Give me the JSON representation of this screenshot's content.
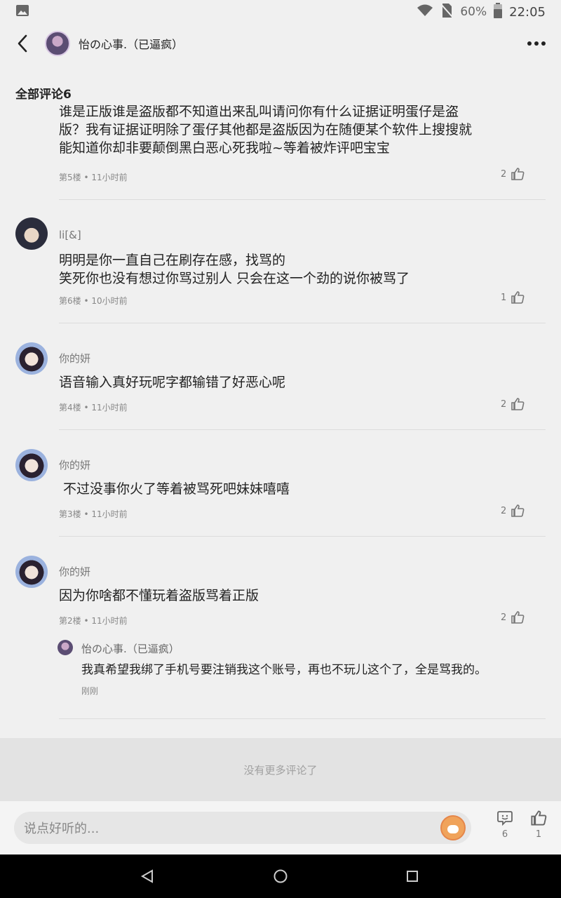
{
  "status_bar": {
    "battery_percent": "60%",
    "time": "22:05"
  },
  "header": {
    "title": "怡の心事.（已逼疯）"
  },
  "section": {
    "title": "全部评论6"
  },
  "comments": [
    {
      "text_lines": [
        "谁是正版谁是盗版都不知道出来乱叫请问你有什么证据证明蛋仔是盗",
        "版？我有证据证明除了蛋仔其他都是盗版因为在随便某个软件上搜搜就",
        "能知道你却非要颠倒黑白恶心死我啦~等着被炸评吧宝宝"
      ],
      "meta": "第5楼 • 11小时前",
      "likes": "2"
    },
    {
      "name": "li[&]",
      "text_lines": [
        "明明是你一直自己在刷存在感，找骂的",
        "笑死你也没有想过你骂过别人 只会在这一个劲的说你被骂了"
      ],
      "meta": "第6楼 • 10小时前",
      "likes": "1"
    },
    {
      "name": "你的妍",
      "text": "语音输入真好玩呢字都输错了好恶心呢",
      "meta": "第4楼 • 11小时前",
      "likes": "2"
    },
    {
      "name": "你的妍",
      "text": " 不过没事你火了等着被骂死吧妹妹嘻嘻",
      "meta": "第3楼 • 11小时前",
      "likes": "2"
    },
    {
      "name": "你的妍",
      "text": "因为你啥都不懂玩着盗版骂着正版",
      "meta": "第2楼 • 11小时前",
      "likes": "2",
      "reply": {
        "name": "怡の心事.（已逼疯）",
        "text": "我真希望我绑了手机号要注销我这个账号，再也不玩儿这个了，全是骂我的。",
        "meta": "刚刚"
      }
    }
  ],
  "footer": {
    "no_more": "没有更多评论了"
  },
  "input_bar": {
    "placeholder": "说点好听的...",
    "comment_count": "6",
    "like_count": "1"
  },
  "icons": {
    "status": [
      "image-icon",
      "wifi-icon",
      "no-sim-icon",
      "battery-icon"
    ],
    "nav": [
      "back-triangle-icon",
      "home-circle-icon",
      "recents-square-icon"
    ]
  }
}
